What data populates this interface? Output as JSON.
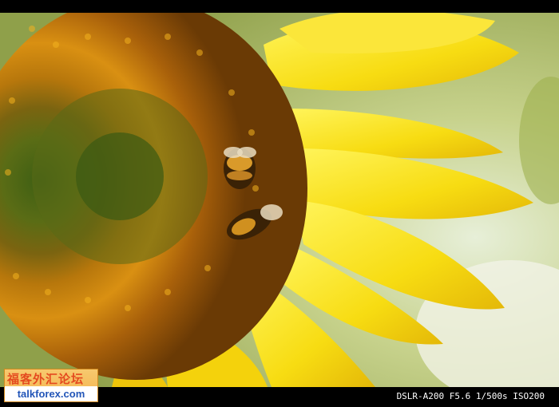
{
  "watermark": {
    "site_text": "福客外汇论坛",
    "domain": "talkforex.com"
  },
  "exif": {
    "caption": "DSLR-A200 F5.6 1/500s ISO200"
  },
  "colors": {
    "border": "#000000",
    "petal": "#f8dd10",
    "disk_outer": "#c9820f",
    "disk_center": "#536b18",
    "bokeh": "#b8c77a"
  }
}
